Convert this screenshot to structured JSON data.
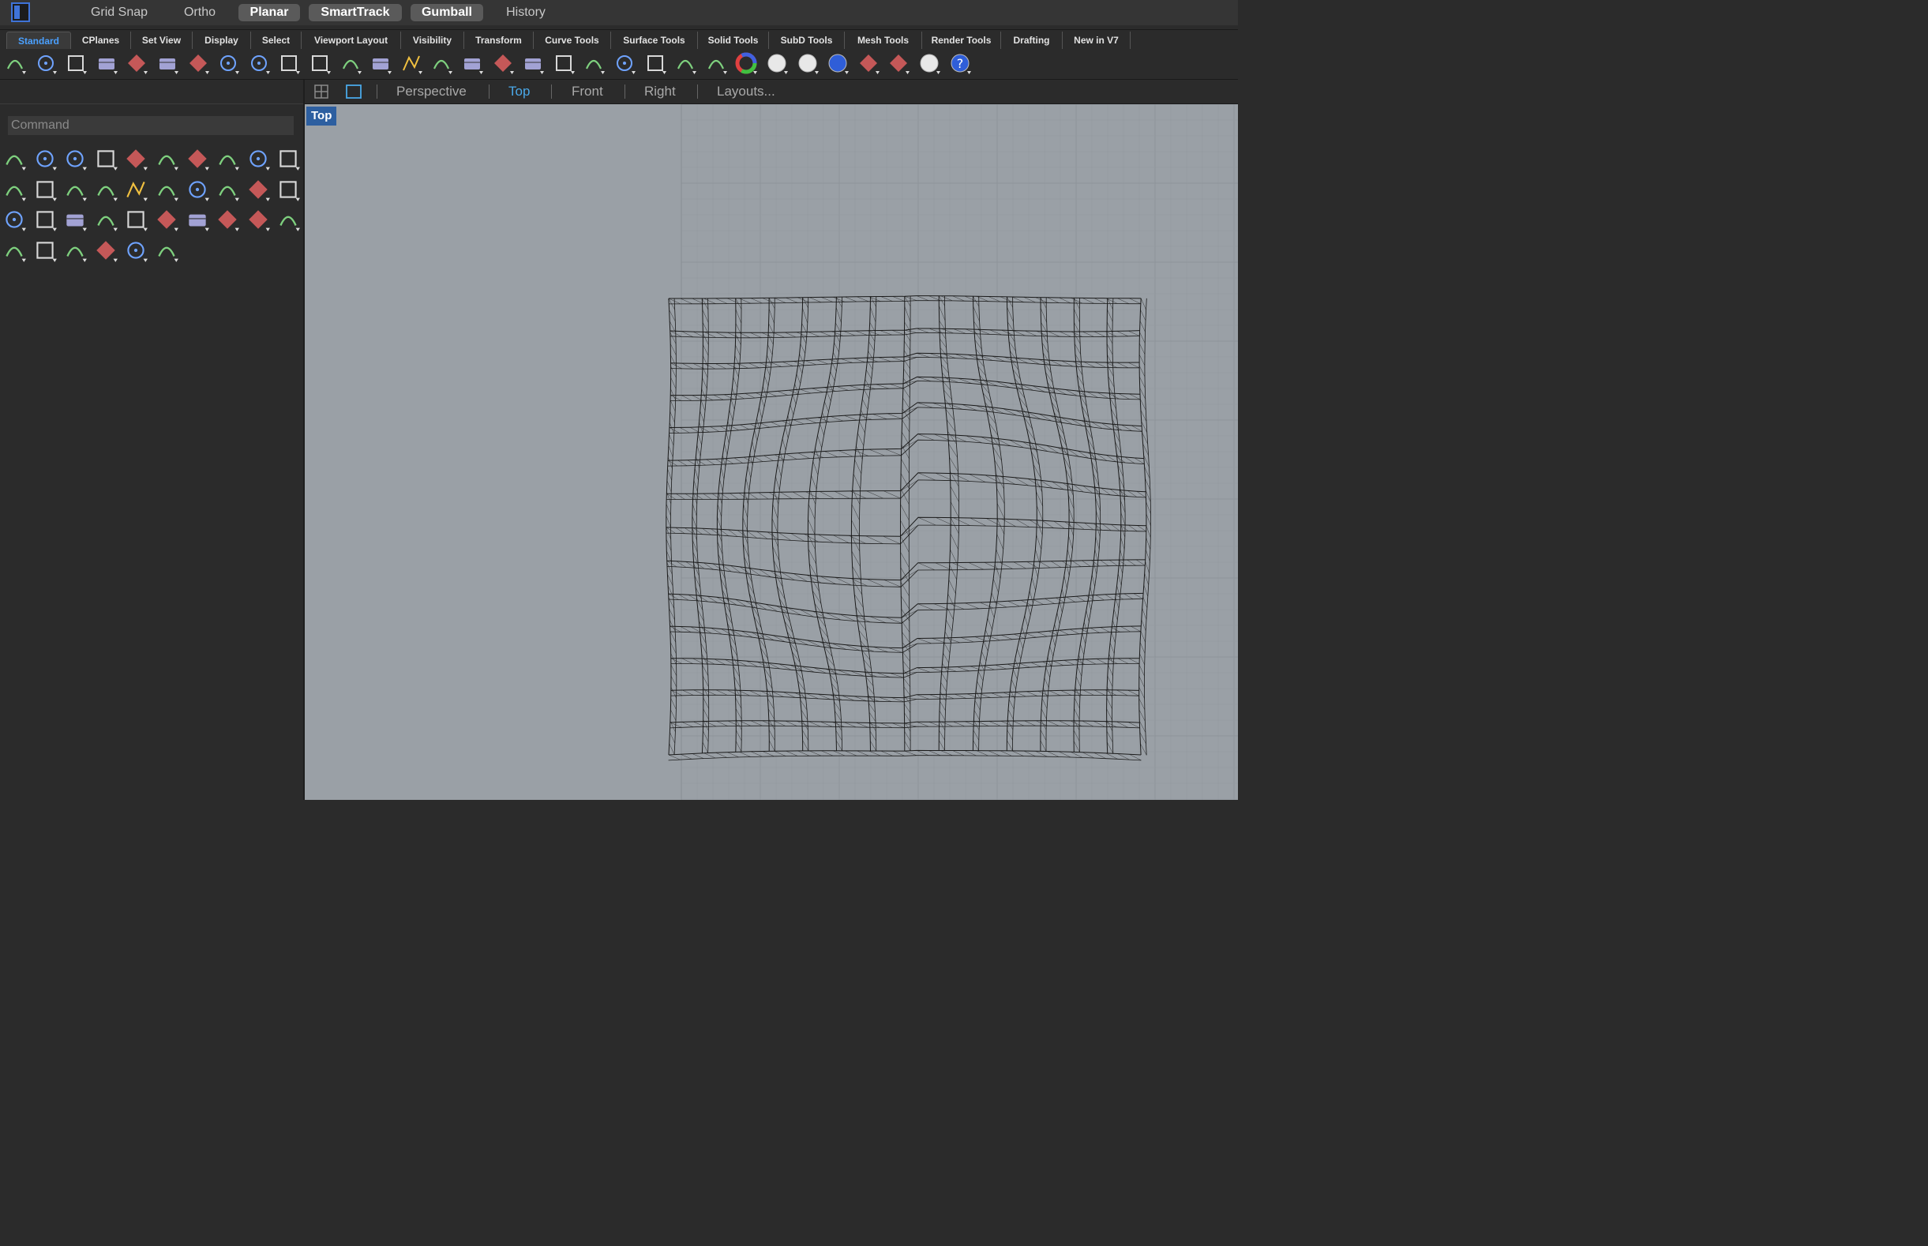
{
  "statusbar": {
    "toggles": [
      {
        "label": "Grid Snap",
        "on": false
      },
      {
        "label": "Ortho",
        "on": false
      },
      {
        "label": "Planar",
        "on": true
      },
      {
        "label": "SmartTrack",
        "on": true
      },
      {
        "label": "Gumball",
        "on": true
      },
      {
        "label": "History",
        "on": false
      }
    ]
  },
  "tabs": [
    "Standard",
    "CPlanes",
    "Set View",
    "Display",
    "Select",
    "Viewport Layout",
    "Visibility",
    "Transform",
    "Curve Tools",
    "Surface Tools",
    "Solid Tools",
    "SubD Tools",
    "Mesh Tools",
    "Render Tools",
    "Drafting",
    "New in V7"
  ],
  "active_tab": "Standard",
  "toolbar_icons": [
    "new-file",
    "open-folder",
    "save",
    "print",
    "import",
    "cut",
    "copy",
    "paste",
    "undo",
    "pan-hand",
    "rotate-view",
    "zoom",
    "zoom-window",
    "zoom-extents",
    "zoom-selected",
    "rotate-camera",
    "four-viewports",
    "car-render",
    "grid-plane",
    "cplane-circle",
    "snap-points",
    "light-bulb",
    "lock",
    "box-render",
    "color-wheel",
    "sphere-wire",
    "sphere-shaded",
    "sphere-blue",
    "filter",
    "transform-axes",
    "render-globe",
    "help"
  ],
  "command": {
    "placeholder": "Command"
  },
  "side_tools": [
    [
      "select-arrow",
      "point",
      "polyline",
      "curve",
      "circle",
      "ellipse",
      "arc",
      "rectangle",
      "polygon",
      "fillet-curve"
    ],
    [
      "surface-corner",
      "surface-extrude",
      "solid-box",
      "boolean-union",
      "torus",
      "plane-surface",
      "explode-join",
      "flame-extrude",
      "trim",
      "split"
    ],
    [
      "group",
      "ungroup",
      "offset-curve",
      "fillet",
      "text",
      "scale",
      "array",
      "edit-tag",
      "block",
      "dimension"
    ],
    [
      "grid-array",
      "mirror-color",
      "render-mat",
      "check",
      "mesh-shape",
      "brush-paint"
    ]
  ],
  "viewport_tabs": [
    "Perspective",
    "Top",
    "Front",
    "Right",
    "Layouts..."
  ],
  "active_viewport_tab": "Top",
  "viewport_label": "Top",
  "colors": {
    "accent": "#4aa0ff",
    "viewport_bg": "#9aa0a6",
    "grid": "#8c9298",
    "wire": "#1a1a1a"
  }
}
